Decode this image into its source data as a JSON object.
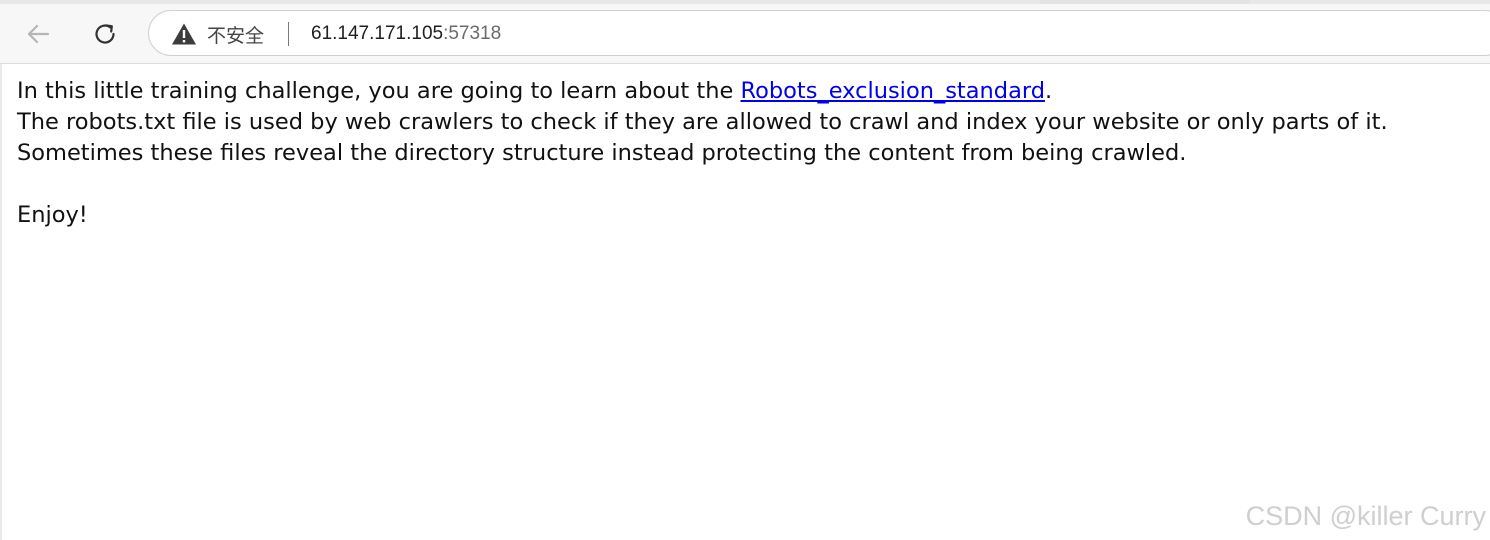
{
  "browser": {
    "security_label": "不安全",
    "url_host": "61.147.171.105",
    "url_port": ":57318"
  },
  "page": {
    "line1_prefix": "In this little training challenge, you are going to learn about the ",
    "link_label": "Robots_exclusion_standard",
    "line1_suffix": ".",
    "line2": "The robots.txt file is used by web crawlers to check if they are allowed to crawl and index your website or only parts of it.",
    "line3": "Sometimes these files reveal the directory structure instead protecting the content from being crawled.",
    "line4": "Enjoy!"
  },
  "watermark": "CSDN @killer Curry",
  "icons": {
    "back": "arrow-left-icon",
    "reload": "reload-icon",
    "security": "warning-triangle-icon"
  }
}
